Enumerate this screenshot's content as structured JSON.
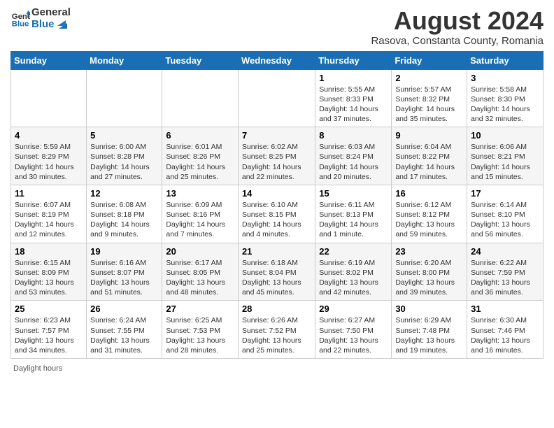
{
  "header": {
    "logo_line1": "General",
    "logo_line2": "Blue",
    "title": "August 2024",
    "subtitle": "Rasova, Constanta County, Romania"
  },
  "columns": [
    "Sunday",
    "Monday",
    "Tuesday",
    "Wednesday",
    "Thursday",
    "Friday",
    "Saturday"
  ],
  "weeks": [
    [
      {
        "day": "",
        "info": ""
      },
      {
        "day": "",
        "info": ""
      },
      {
        "day": "",
        "info": ""
      },
      {
        "day": "",
        "info": ""
      },
      {
        "day": "1",
        "info": "Sunrise: 5:55 AM\nSunset: 8:33 PM\nDaylight: 14 hours\nand 37 minutes."
      },
      {
        "day": "2",
        "info": "Sunrise: 5:57 AM\nSunset: 8:32 PM\nDaylight: 14 hours\nand 35 minutes."
      },
      {
        "day": "3",
        "info": "Sunrise: 5:58 AM\nSunset: 8:30 PM\nDaylight: 14 hours\nand 32 minutes."
      }
    ],
    [
      {
        "day": "4",
        "info": "Sunrise: 5:59 AM\nSunset: 8:29 PM\nDaylight: 14 hours\nand 30 minutes."
      },
      {
        "day": "5",
        "info": "Sunrise: 6:00 AM\nSunset: 8:28 PM\nDaylight: 14 hours\nand 27 minutes."
      },
      {
        "day": "6",
        "info": "Sunrise: 6:01 AM\nSunset: 8:26 PM\nDaylight: 14 hours\nand 25 minutes."
      },
      {
        "day": "7",
        "info": "Sunrise: 6:02 AM\nSunset: 8:25 PM\nDaylight: 14 hours\nand 22 minutes."
      },
      {
        "day": "8",
        "info": "Sunrise: 6:03 AM\nSunset: 8:24 PM\nDaylight: 14 hours\nand 20 minutes."
      },
      {
        "day": "9",
        "info": "Sunrise: 6:04 AM\nSunset: 8:22 PM\nDaylight: 14 hours\nand 17 minutes."
      },
      {
        "day": "10",
        "info": "Sunrise: 6:06 AM\nSunset: 8:21 PM\nDaylight: 14 hours\nand 15 minutes."
      }
    ],
    [
      {
        "day": "11",
        "info": "Sunrise: 6:07 AM\nSunset: 8:19 PM\nDaylight: 14 hours\nand 12 minutes."
      },
      {
        "day": "12",
        "info": "Sunrise: 6:08 AM\nSunset: 8:18 PM\nDaylight: 14 hours\nand 9 minutes."
      },
      {
        "day": "13",
        "info": "Sunrise: 6:09 AM\nSunset: 8:16 PM\nDaylight: 14 hours\nand 7 minutes."
      },
      {
        "day": "14",
        "info": "Sunrise: 6:10 AM\nSunset: 8:15 PM\nDaylight: 14 hours\nand 4 minutes."
      },
      {
        "day": "15",
        "info": "Sunrise: 6:11 AM\nSunset: 8:13 PM\nDaylight: 14 hours\nand 1 minute."
      },
      {
        "day": "16",
        "info": "Sunrise: 6:12 AM\nSunset: 8:12 PM\nDaylight: 13 hours\nand 59 minutes."
      },
      {
        "day": "17",
        "info": "Sunrise: 6:14 AM\nSunset: 8:10 PM\nDaylight: 13 hours\nand 56 minutes."
      }
    ],
    [
      {
        "day": "18",
        "info": "Sunrise: 6:15 AM\nSunset: 8:09 PM\nDaylight: 13 hours\nand 53 minutes."
      },
      {
        "day": "19",
        "info": "Sunrise: 6:16 AM\nSunset: 8:07 PM\nDaylight: 13 hours\nand 51 minutes."
      },
      {
        "day": "20",
        "info": "Sunrise: 6:17 AM\nSunset: 8:05 PM\nDaylight: 13 hours\nand 48 minutes."
      },
      {
        "day": "21",
        "info": "Sunrise: 6:18 AM\nSunset: 8:04 PM\nDaylight: 13 hours\nand 45 minutes."
      },
      {
        "day": "22",
        "info": "Sunrise: 6:19 AM\nSunset: 8:02 PM\nDaylight: 13 hours\nand 42 minutes."
      },
      {
        "day": "23",
        "info": "Sunrise: 6:20 AM\nSunset: 8:00 PM\nDaylight: 13 hours\nand 39 minutes."
      },
      {
        "day": "24",
        "info": "Sunrise: 6:22 AM\nSunset: 7:59 PM\nDaylight: 13 hours\nand 36 minutes."
      }
    ],
    [
      {
        "day": "25",
        "info": "Sunrise: 6:23 AM\nSunset: 7:57 PM\nDaylight: 13 hours\nand 34 minutes."
      },
      {
        "day": "26",
        "info": "Sunrise: 6:24 AM\nSunset: 7:55 PM\nDaylight: 13 hours\nand 31 minutes."
      },
      {
        "day": "27",
        "info": "Sunrise: 6:25 AM\nSunset: 7:53 PM\nDaylight: 13 hours\nand 28 minutes."
      },
      {
        "day": "28",
        "info": "Sunrise: 6:26 AM\nSunset: 7:52 PM\nDaylight: 13 hours\nand 25 minutes."
      },
      {
        "day": "29",
        "info": "Sunrise: 6:27 AM\nSunset: 7:50 PM\nDaylight: 13 hours\nand 22 minutes."
      },
      {
        "day": "30",
        "info": "Sunrise: 6:29 AM\nSunset: 7:48 PM\nDaylight: 13 hours\nand 19 minutes."
      },
      {
        "day": "31",
        "info": "Sunrise: 6:30 AM\nSunset: 7:46 PM\nDaylight: 13 hours\nand 16 minutes."
      }
    ]
  ],
  "footer": "Daylight hours"
}
